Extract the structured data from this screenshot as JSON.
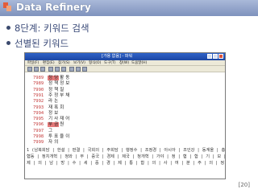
{
  "slide": {
    "title": "Data Refinery",
    "bullets": [
      "8단계: 키워드 검색",
      "선별된 키워드"
    ],
    "page_number": "[20]"
  },
  "window": {
    "title": "[가용 없음] - 파워",
    "menu": [
      "파일(F)",
      "편집(E)",
      "찾기(S)",
      "보기(V)",
      "형식(O)",
      "도구(T)",
      "창(W)",
      "도움말(H)"
    ]
  },
  "keywords": [
    {
      "num": "7989",
      "parts": [
        "정",
        "당",
        "활",
        "동"
      ],
      "hl": [
        0,
        1
      ]
    },
    {
      "num": "7989",
      "parts": [
        "정",
        "책",
        "정",
        "보"
      ],
      "hl": []
    },
    {
      "num": "7990",
      "parts": [
        "정",
        "책",
        "질"
      ],
      "hl": []
    },
    {
      "num": "7991",
      "parts": [
        "주",
        "정",
        "부",
        "채"
      ],
      "hl": []
    },
    {
      "num": "7992",
      "parts": [
        "라",
        "논"
      ],
      "hl": []
    },
    {
      "num": "7993",
      "parts": [
        "재",
        "폭",
        "회"
      ],
      "hl": []
    },
    {
      "num": "7994",
      "parts": [
        "정",
        "보"
      ],
      "hl": []
    },
    {
      "num": "7995",
      "parts": [
        "기",
        "사",
        "재",
        "어"
      ],
      "hl": []
    },
    {
      "num": "7996",
      "parts": [
        "부",
        "금",
        "원"
      ],
      "hl": [
        0,
        1
      ]
    },
    {
      "num": "7997",
      "parts": [
        "그"
      ],
      "hl": []
    },
    {
      "num": "7998",
      "parts": [
        "투",
        "표",
        "율",
        "이"
      ],
      "hl": []
    },
    {
      "num": "7999",
      "parts": [
        "자",
        "의"
      ],
      "hl": []
    }
  ],
  "lists": [
    "1 (남북회담 | 한설 | 판결 | 국회의 | 주회담 | 행정수 | 조정경 | 아시아 | 조인강 | 동계올 | 총학이 | 감세 | 문제 | 남의 |",
    "협동 | 정치개혁 | 청와 | 부 | 중국 | 경제 | 제국 | 청개혁 | 가야 | 정 | 협 | 합 | 기 | 보 | 정 | 해 | 원 | 설 | 교 | 통 | 재 | 나 | 다 |",
    "제 | 의 | 남 | 방 | 수 | 세 | 중 | 경 | 제 | 통 | 합 | 의 | 사 | 여 | 분 | 주 | 의 | 정 | 대 | 금 | 지 | 원 | 명 | 비 | 경 | 제 | ------"
  ],
  "colors": {
    "accent": "#7f92bd",
    "highlight": "#e57a7a",
    "number": "#c43b3b"
  }
}
